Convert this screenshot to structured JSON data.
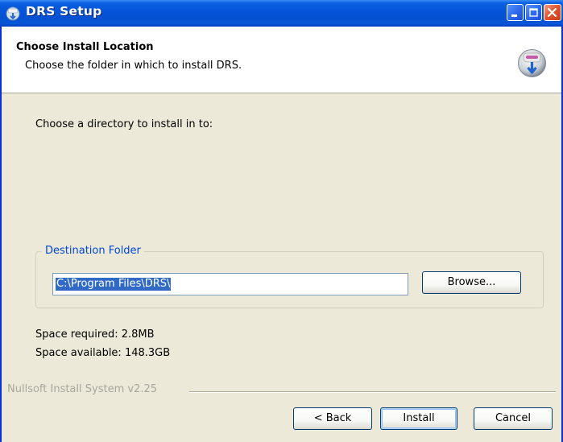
{
  "window": {
    "title": "DRS Setup",
    "controls": [
      "minimize-icon",
      "maximize-icon",
      "close-icon"
    ]
  },
  "header": {
    "title": "Choose Install Location",
    "subtitle": "Choose the folder in which to install DRS.",
    "icon": "installer-disk-icon"
  },
  "main": {
    "prompt": "Choose a directory to install in to:",
    "destination": {
      "legend": "Destination Folder",
      "path": "C:\\Program Files\\DRS\\",
      "browse_label": "Browse..."
    },
    "space_required": "Space required: 2.8MB",
    "space_available": "Space available: 148.3GB"
  },
  "footer": {
    "branding": "Nullsoft Install System v2.25",
    "back_label": "< Back",
    "install_label": "Install",
    "cancel_label": "Cancel"
  },
  "colors": {
    "titlebar": "#0553d8",
    "selection": "#316ac5",
    "legend_text": "#0046d5",
    "dialog_bg": "#ece9d8"
  }
}
